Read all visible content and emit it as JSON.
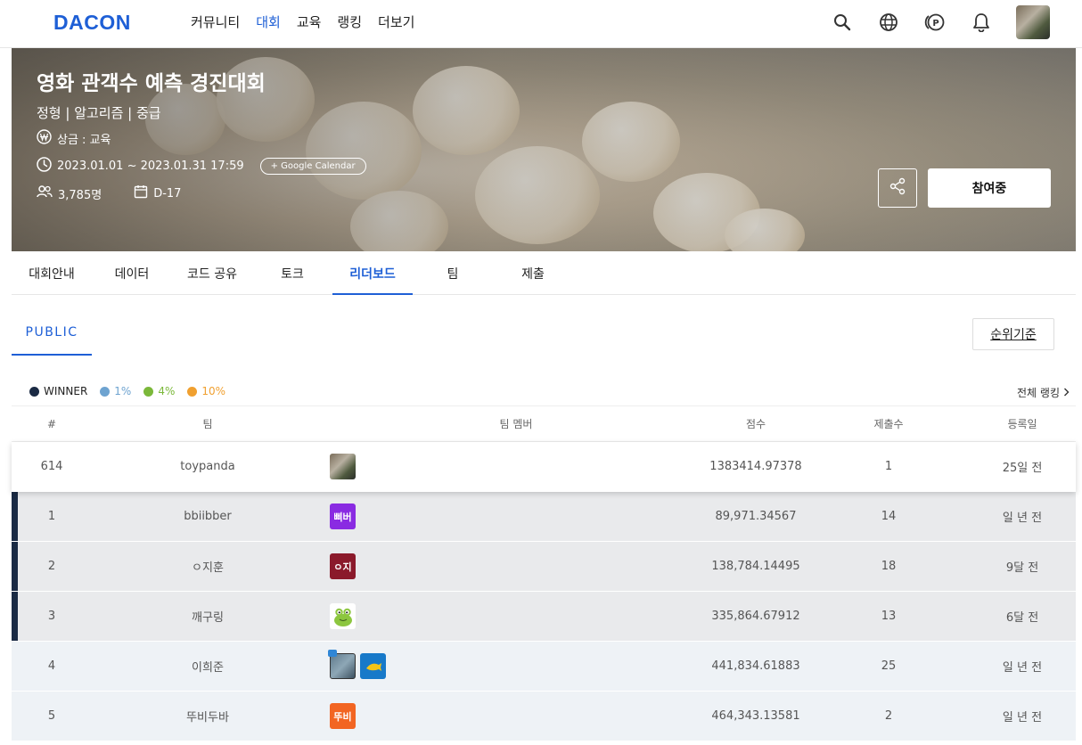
{
  "nav": {
    "logo": "DACON",
    "menu": [
      {
        "label": "커뮤니티",
        "active": false
      },
      {
        "label": "대회",
        "active": true
      },
      {
        "label": "교육",
        "active": false
      },
      {
        "label": "랭킹",
        "active": false
      },
      {
        "label": "더보기",
        "active": false
      }
    ],
    "icons": [
      "search-icon",
      "globe-icon",
      "point-icon",
      "bell-icon"
    ]
  },
  "banner": {
    "title": "영화 관객수 예측 경진대회",
    "subtitle": "정형 | 알고리즘 | 중급",
    "prize": "상금 : 교육",
    "period": "2023.01.01 ~ 2023.01.31 17:59",
    "calendar_button": "+ Google Calendar",
    "participants": "3,785명",
    "dday": "D-17",
    "join_button": "참여중"
  },
  "tabs": [
    {
      "label": "대회안내",
      "active": false
    },
    {
      "label": "데이터",
      "active": false
    },
    {
      "label": "코드 공유",
      "active": false
    },
    {
      "label": "토크",
      "active": false
    },
    {
      "label": "리더보드",
      "active": true
    },
    {
      "label": "팀",
      "active": false
    },
    {
      "label": "제출",
      "active": false
    }
  ],
  "leaderboard": {
    "public_tab": "PUBLIC",
    "rank_basis_button": "순위기준",
    "all_ranking_link": "전체 랭킹",
    "legend": [
      {
        "label": "WINNER",
        "color": "#1a2a44",
        "text_color": "#222222"
      },
      {
        "label": "1%",
        "color": "#6ea3d0",
        "text_color": "#6ea3d0"
      },
      {
        "label": "4%",
        "color": "#7bb83a",
        "text_color": "#7bb83a"
      },
      {
        "label": "10%",
        "color": "#f0a030",
        "text_color": "#f0a030"
      }
    ],
    "headers": {
      "rank": "#",
      "team": "팀",
      "members": "팀 멤버",
      "score": "점수",
      "submissions": "제출수",
      "date": "등록일"
    },
    "rows": [
      {
        "rank": "614",
        "team": "toypanda",
        "score": "1383414.97378",
        "submissions": "1",
        "date": "25일 전"
      },
      {
        "rank": "1",
        "team": "bbiibber",
        "score": "89,971.34567",
        "submissions": "14",
        "date": "일 년 전",
        "badge": "삐버",
        "badge_color": "#8a2be2"
      },
      {
        "rank": "2",
        "team": "ㅇ지훈",
        "score": "138,784.14495",
        "submissions": "18",
        "date": "9달 전",
        "badge": "ㅇ지",
        "badge_color": "#8b1a2b"
      },
      {
        "rank": "3",
        "team": "깨구링",
        "score": "335,864.67912",
        "submissions": "13",
        "date": "6달 전"
      },
      {
        "rank": "4",
        "team": "이희준",
        "score": "441,834.61883",
        "submissions": "25",
        "date": "일 년 전"
      },
      {
        "rank": "5",
        "team": "뚜비두바",
        "score": "464,343.13581",
        "submissions": "2",
        "date": "일 년 전",
        "badge": "뚜비",
        "badge_color": "#f26522"
      }
    ]
  }
}
